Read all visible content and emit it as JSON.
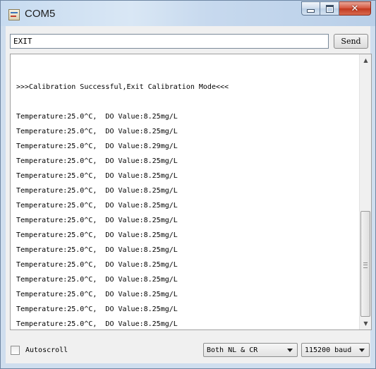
{
  "window": {
    "title": "COM5",
    "close_glyph": "✕"
  },
  "input": {
    "value": "EXIT",
    "send_label": "Send"
  },
  "output": {
    "lines": [
      ">>>Calibration Successful,Exit Calibration Mode<<<",
      "",
      "Temperature:25.0^C,  DO Value:8.25mg/L",
      "Temperature:25.0^C,  DO Value:8.25mg/L",
      "Temperature:25.0^C,  DO Value:8.29mg/L",
      "Temperature:25.0^C,  DO Value:8.25mg/L",
      "Temperature:25.0^C,  DO Value:8.25mg/L",
      "Temperature:25.0^C,  DO Value:8.25mg/L",
      "Temperature:25.0^C,  DO Value:8.25mg/L",
      "Temperature:25.0^C,  DO Value:8.25mg/L",
      "Temperature:25.0^C,  DO Value:8.25mg/L",
      "Temperature:25.0^C,  DO Value:8.25mg/L",
      "Temperature:25.0^C,  DO Value:8.25mg/L",
      "Temperature:25.0^C,  DO Value:8.25mg/L",
      "Temperature:25.0^C,  DO Value:8.25mg/L",
      "Temperature:25.0^C,  DO Value:8.25mg/L",
      "Temperature:25.0^C,  DO Value:8.25mg/L",
      "Temperature:25.0^C,  DO Value:8.25mg/L"
    ]
  },
  "bottom": {
    "autoscroll_label": "Autoscroll",
    "autoscroll_checked": false,
    "line_ending": "Both NL & CR",
    "baud": "115200 baud"
  },
  "icons": {
    "app": "serial-monitor-icon",
    "minimize": "minimize-icon",
    "maximize": "maximize-icon",
    "close": "close-icon",
    "scroll_up": "scroll-up-arrow-icon",
    "scroll_down": "scroll-down-arrow-icon",
    "dropdown": "chevron-down-icon"
  },
  "colors": {
    "titlebar": "#d9e7f5",
    "close_button": "#c1381e"
  }
}
